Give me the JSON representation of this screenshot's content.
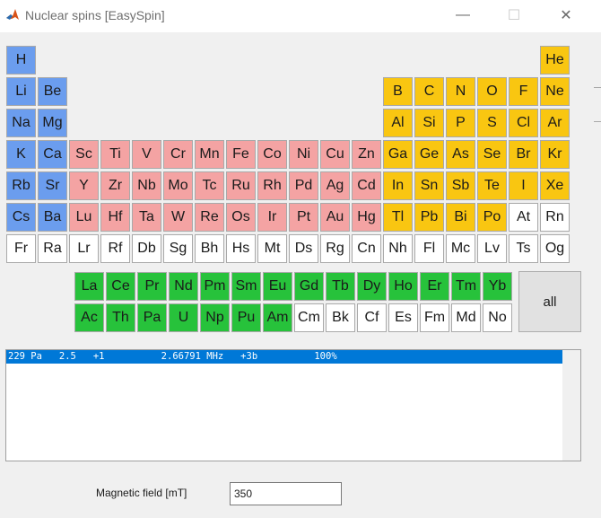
{
  "window": {
    "title": "Nuclear spins [EasySpin]",
    "minimize_glyph": "—",
    "maximize_glyph": "☐",
    "close_glyph": "✕"
  },
  "colors": {
    "alkali": "#6b9dee",
    "transition_metal": "#f4a3a3",
    "p_block": "#f9c611",
    "lanthanide_actinide": "#27c23b",
    "none": "#ffffff",
    "selection": "#0078d7"
  },
  "periodic_table": {
    "main": [
      [
        [
          "H",
          "alkali"
        ],
        null,
        null,
        null,
        null,
        null,
        null,
        null,
        null,
        null,
        null,
        null,
        null,
        null,
        null,
        null,
        null,
        [
          "He",
          "pb"
        ]
      ],
      [
        [
          "Li",
          "alkali"
        ],
        [
          "Be",
          "alkali"
        ],
        null,
        null,
        null,
        null,
        null,
        null,
        null,
        null,
        null,
        null,
        [
          "B",
          "pb"
        ],
        [
          "C",
          "pb"
        ],
        [
          "N",
          "pb"
        ],
        [
          "O",
          "pb"
        ],
        [
          "F",
          "pb"
        ],
        [
          "Ne",
          "pb"
        ]
      ],
      [
        [
          "Na",
          "alkali"
        ],
        [
          "Mg",
          "alkali"
        ],
        null,
        null,
        null,
        null,
        null,
        null,
        null,
        null,
        null,
        null,
        [
          "Al",
          "pb"
        ],
        [
          "Si",
          "pb"
        ],
        [
          "P",
          "pb"
        ],
        [
          "S",
          "pb"
        ],
        [
          "Cl",
          "pb"
        ],
        [
          "Ar",
          "pb"
        ]
      ],
      [
        [
          "K",
          "alkali"
        ],
        [
          "Ca",
          "alkali"
        ],
        [
          "Sc",
          "tm"
        ],
        [
          "Ti",
          "tm"
        ],
        [
          "V",
          "tm"
        ],
        [
          "Cr",
          "tm"
        ],
        [
          "Mn",
          "tm"
        ],
        [
          "Fe",
          "tm"
        ],
        [
          "Co",
          "tm"
        ],
        [
          "Ni",
          "tm"
        ],
        [
          "Cu",
          "tm"
        ],
        [
          "Zn",
          "tm"
        ],
        [
          "Ga",
          "pb"
        ],
        [
          "Ge",
          "pb"
        ],
        [
          "As",
          "pb"
        ],
        [
          "Se",
          "pb"
        ],
        [
          "Br",
          "pb"
        ],
        [
          "Kr",
          "pb"
        ]
      ],
      [
        [
          "Rb",
          "alkali"
        ],
        [
          "Sr",
          "alkali"
        ],
        [
          "Y",
          "tm"
        ],
        [
          "Zr",
          "tm"
        ],
        [
          "Nb",
          "tm"
        ],
        [
          "Mo",
          "tm"
        ],
        [
          "Tc",
          "tm"
        ],
        [
          "Ru",
          "tm"
        ],
        [
          "Rh",
          "tm"
        ],
        [
          "Pd",
          "tm"
        ],
        [
          "Ag",
          "tm"
        ],
        [
          "Cd",
          "tm"
        ],
        [
          "In",
          "pb"
        ],
        [
          "Sn",
          "pb"
        ],
        [
          "Sb",
          "pb"
        ],
        [
          "Te",
          "pb"
        ],
        [
          "I",
          "pb"
        ],
        [
          "Xe",
          "pb"
        ]
      ],
      [
        [
          "Cs",
          "alkali"
        ],
        [
          "Ba",
          "alkali"
        ],
        [
          "Lu",
          "tm"
        ],
        [
          "Hf",
          "tm"
        ],
        [
          "Ta",
          "tm"
        ],
        [
          "W",
          "tm"
        ],
        [
          "Re",
          "tm"
        ],
        [
          "Os",
          "tm"
        ],
        [
          "Ir",
          "tm"
        ],
        [
          "Pt",
          "tm"
        ],
        [
          "Au",
          "tm"
        ],
        [
          "Hg",
          "tm"
        ],
        [
          "Tl",
          "pb"
        ],
        [
          "Pb",
          "pb"
        ],
        [
          "Bi",
          "pb"
        ],
        [
          "Po",
          "pb"
        ],
        [
          "At",
          "none"
        ],
        [
          "Rn",
          "none"
        ]
      ],
      [
        [
          "Fr",
          "none"
        ],
        [
          "Ra",
          "none"
        ],
        [
          "Lr",
          "none"
        ],
        [
          "Rf",
          "none"
        ],
        [
          "Db",
          "none"
        ],
        [
          "Sg",
          "none"
        ],
        [
          "Bh",
          "none"
        ],
        [
          "Hs",
          "none"
        ],
        [
          "Mt",
          "none"
        ],
        [
          "Ds",
          "none"
        ],
        [
          "Rg",
          "none"
        ],
        [
          "Cn",
          "none"
        ],
        [
          "Nh",
          "none"
        ],
        [
          "Fl",
          "none"
        ],
        [
          "Mc",
          "none"
        ],
        [
          "Lv",
          "none"
        ],
        [
          "Ts",
          "none"
        ],
        [
          "Og",
          "none"
        ]
      ]
    ],
    "f_block": [
      [
        [
          "La",
          "lan"
        ],
        [
          "Ce",
          "lan"
        ],
        [
          "Pr",
          "lan"
        ],
        [
          "Nd",
          "lan"
        ],
        [
          "Pm",
          "lan"
        ],
        [
          "Sm",
          "lan"
        ],
        [
          "Eu",
          "lan"
        ],
        [
          "Gd",
          "lan"
        ],
        [
          "Tb",
          "lan"
        ],
        [
          "Dy",
          "lan"
        ],
        [
          "Ho",
          "lan"
        ],
        [
          "Er",
          "lan"
        ],
        [
          "Tm",
          "lan"
        ],
        [
          "Yb",
          "lan"
        ]
      ],
      [
        [
          "Ac",
          "lan"
        ],
        [
          "Th",
          "lan"
        ],
        [
          "Pa",
          "lan"
        ],
        [
          "U",
          "lan"
        ],
        [
          "Np",
          "lan"
        ],
        [
          "Pu",
          "lan"
        ],
        [
          "Am",
          "lan"
        ],
        [
          "Cm",
          "none"
        ],
        [
          "Bk",
          "none"
        ],
        [
          "Cf",
          "none"
        ],
        [
          "Es",
          "none"
        ],
        [
          "Fm",
          "none"
        ],
        [
          "Md",
          "none"
        ],
        [
          "No",
          "none"
        ]
      ]
    ]
  },
  "all_button": {
    "label": "all"
  },
  "isotope_list": {
    "rows": [
      "229 Pa   2.5   +1          2.66791 MHz   +3b          100%"
    ]
  },
  "magnetic_field": {
    "label": "Magnetic field [mT]",
    "value": "350"
  }
}
